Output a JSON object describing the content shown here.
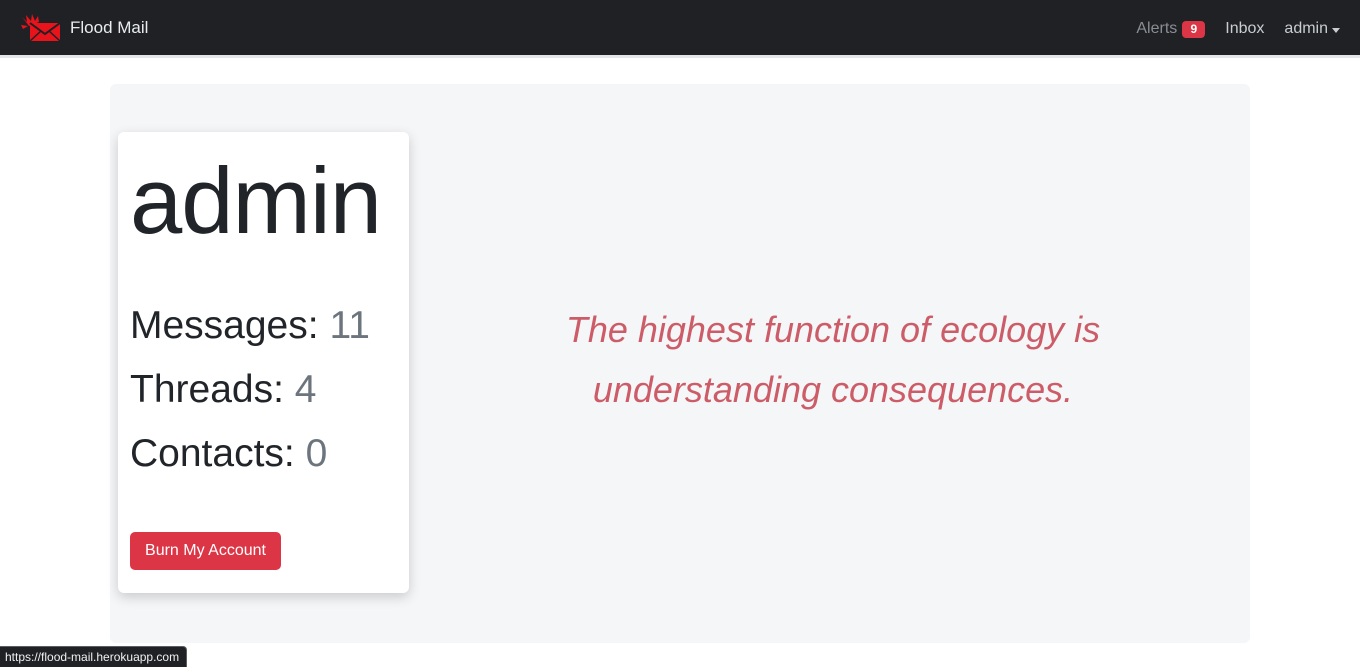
{
  "navbar": {
    "brand": {
      "name": "Flood Mail",
      "logo_icon": "flaming-envelope-icon",
      "logo_color": "#e8131b"
    },
    "alerts": {
      "label": "Alerts",
      "count": "9"
    },
    "inbox_label": "Inbox",
    "user_menu_label": "admin"
  },
  "profile": {
    "username": "admin",
    "stats": {
      "messages_label": "Messages:",
      "messages_value": "11",
      "threads_label": "Threads:",
      "threads_value": "4",
      "contacts_label": "Contacts:",
      "contacts_value": "0"
    },
    "burn_button_label": "Burn My Account"
  },
  "quote": {
    "line1": "The highest function of ecology is",
    "line2": "understanding consequences."
  },
  "status_bar": {
    "url": "https://flood-mail.herokuapp.com"
  },
  "colors": {
    "navbar_bg": "#1f2125",
    "danger": "#dc3545",
    "quote": "#cc5c67",
    "panel_bg": "#f5f6f8"
  }
}
